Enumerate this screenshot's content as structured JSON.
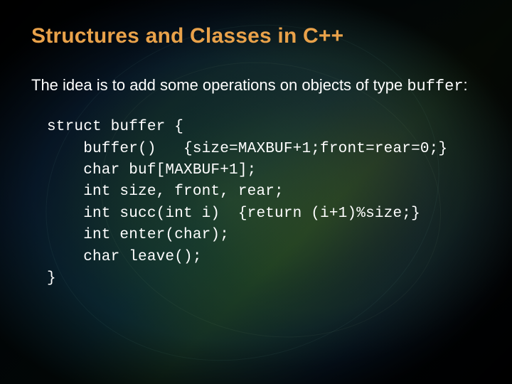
{
  "title": "Structures and Classes in C++",
  "intro_prefix": "The idea is to add some operations on objects of type ",
  "intro_code_word": "buffer",
  "intro_suffix": ":",
  "code": "struct buffer {\n    buffer()   {size=MAXBUF+1;front=rear=0;}\n    char buf[MAXBUF+1];\n    int size, front, rear;\n    int succ(int i)  {return (i+1)%size;}\n    int enter(char);\n    char leave();\n}"
}
